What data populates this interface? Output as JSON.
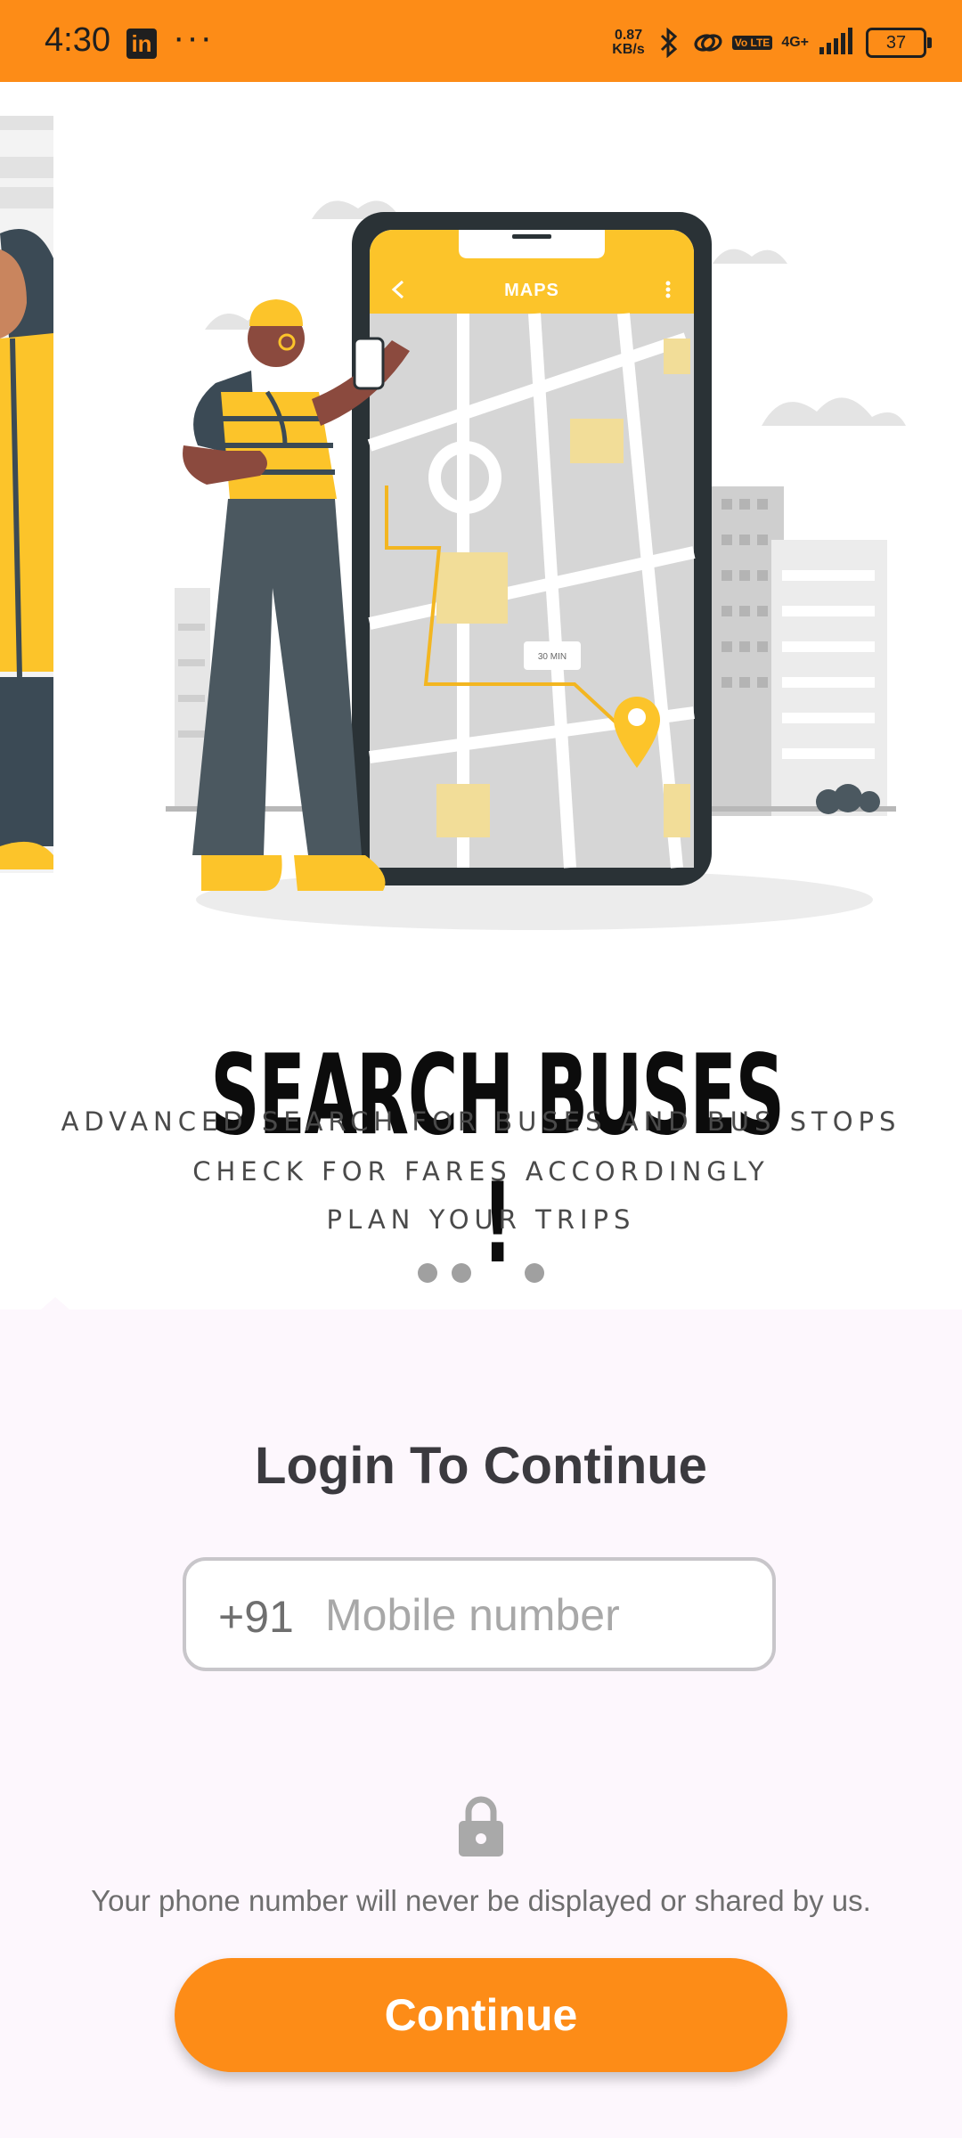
{
  "status_bar": {
    "time": "4:30",
    "overflow": "···",
    "net_speed_value": "0.87",
    "net_speed_unit": "KB/s",
    "volte": "Vo LTE",
    "network": "4G+",
    "battery": "37",
    "icons": [
      "linkedin-icon",
      "bluetooth-icon",
      "hotspot-icon",
      "volte-icon",
      "signal-icon",
      "battery-icon"
    ]
  },
  "onboarding": {
    "phone_screen_title": "MAPS",
    "map_badge": "30 MIN",
    "title": "SEARCH BUSES !",
    "features": [
      "ADVANCED SEARCH FOR BUSES AND BUS STOPS",
      "CHECK FOR FARES ACCORDINGLY",
      "PLAN YOUR TRIPS"
    ],
    "pager_count": 3
  },
  "login": {
    "title": "Login To Continue",
    "country_code": "+91",
    "phone_placeholder": "Mobile number",
    "phone_value": "",
    "privacy_note": "Your phone number will never be displayed or shared by us.",
    "continue_label": "Continue"
  },
  "colors": {
    "accent": "#fd8c17",
    "illustration_yellow": "#fcc42a",
    "background": "#fdf7fd"
  }
}
